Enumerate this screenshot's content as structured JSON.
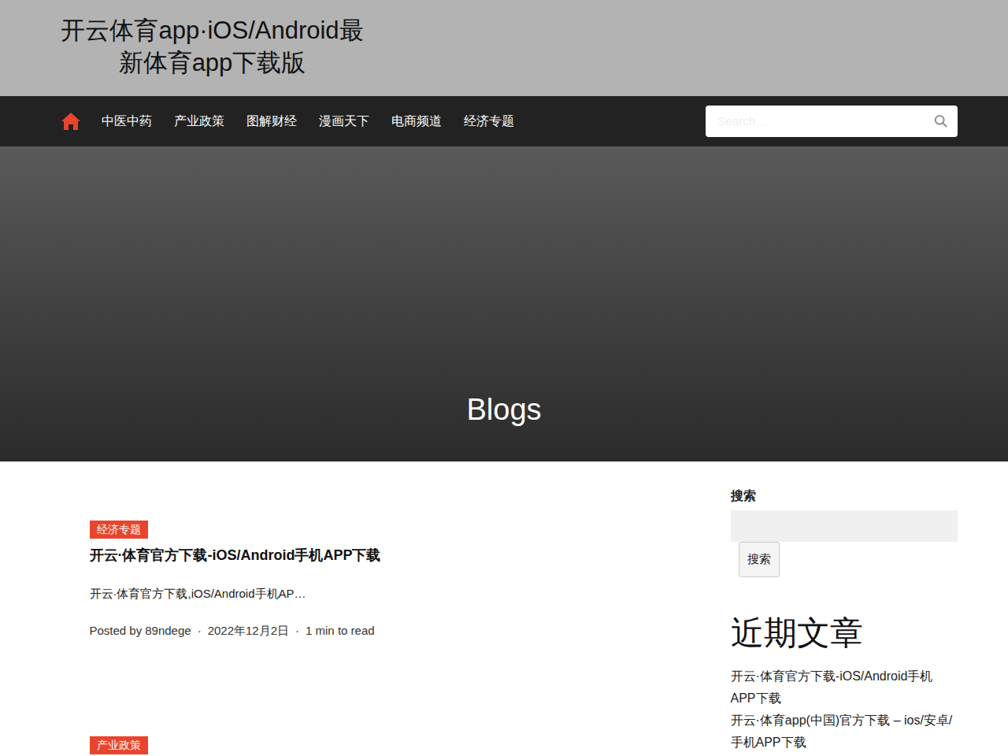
{
  "site": {
    "title": "开云体育app·iOS/Android最新体育app下载版"
  },
  "nav": {
    "home": {
      "selected": true
    },
    "items": [
      {
        "label": "中医中药",
        "selected": false
      },
      {
        "label": "产业政策",
        "selected": false
      },
      {
        "label": "图解财经",
        "selected": false
      },
      {
        "label": "漫画天下",
        "selected": false
      },
      {
        "label": "电商频道",
        "selected": false
      },
      {
        "label": "经济专题",
        "selected": false
      }
    ]
  },
  "search": {
    "placeholder": "Search …"
  },
  "hero": {
    "title": "Blogs"
  },
  "posts": [
    {
      "category": "经济专题",
      "title": "开云·体育官方下载-iOS/Android手机APP下载",
      "excerpt": "开云·体育官方下载,iOS/Android手机AP…",
      "meta": {
        "posted_by": "Posted by",
        "author": "89ndege",
        "separator": "·",
        "date": "2022年12月2日",
        "read": "1 min to read"
      }
    },
    {
      "category": "产业政策"
    }
  ],
  "sidebar": {
    "search_title": "搜索",
    "search_button": "搜索",
    "recent_title": "近期文章",
    "recent": [
      "开云·体育官方下载-iOS/Android手机APP下载",
      "开云·体育app(中国)官方下载 – ios/安卓/手机APP下载"
    ]
  }
}
